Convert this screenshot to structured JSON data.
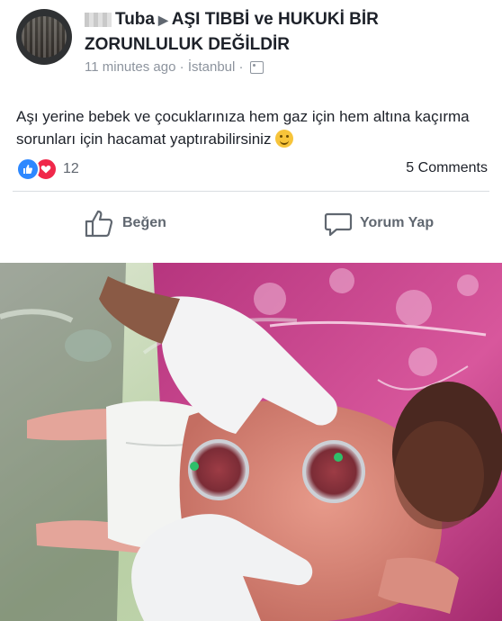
{
  "post": {
    "author": "Tuba",
    "target_page": "AŞI TIBBİ ve HUKUKİ BİR ZORUNLULUK DEĞİLDİR",
    "time": "11 minutes ago",
    "location": "İstanbul",
    "separator": "·",
    "text": "Aşı yerine bebek ve çocuklarınıza hem gaz için hem altına kaçırma sorunları için hacamat yaptırabilirsiniz",
    "reaction_count": "12",
    "comments_label": "5 Comments"
  },
  "actions": {
    "like_label": "Beğen",
    "comment_label": "Yorum Yap"
  },
  "colors": {
    "like_blue": "#2d88ff",
    "love_red": "#f0284a",
    "meta_gray": "#8d949e"
  },
  "icons": {
    "reaction_like": "thumbs-up-icon",
    "reaction_love": "heart-icon",
    "privacy": "globe-icon",
    "like_action": "thumbs-up-outline-icon",
    "comment_action": "speech-bubble-icon"
  }
}
